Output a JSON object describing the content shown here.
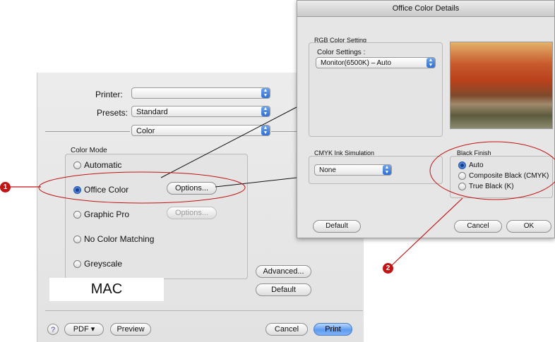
{
  "print_dialog": {
    "printer_label": "Printer:",
    "printer_value": "",
    "presets_label": "Presets:",
    "presets_value": "Standard",
    "pane_value": "Color",
    "color_mode_label": "Color Mode",
    "options": [
      {
        "label": "Automatic",
        "selected": false
      },
      {
        "label": "Office Color",
        "selected": true
      },
      {
        "label": "Graphic Pro",
        "selected": false
      },
      {
        "label": "No Color Matching",
        "selected": false
      },
      {
        "label": "Greyscale",
        "selected": false
      }
    ],
    "options_button": "Options...",
    "options_button_disabled": "Options...",
    "advanced_button": "Advanced...",
    "default_button": "Default",
    "help_button": "?",
    "pdf_button": "PDF ▾",
    "preview_button": "Preview",
    "cancel_button": "Cancel",
    "print_button": "Print"
  },
  "mac_label": "MAC",
  "details_dialog": {
    "title": "Office Color Details",
    "rgb_group_label": "RGB Color Setting",
    "color_settings_label": "Color Settings :",
    "color_settings_value": "Monitor(6500K) – Auto",
    "cmyk_group_label": "CMYK Ink Simulation",
    "cmyk_value": "None",
    "black_finish_label": "Black Finish",
    "black_finish_options": [
      {
        "label": "Auto",
        "selected": true
      },
      {
        "label": "Composite Black (CMYK)",
        "selected": false
      },
      {
        "label": "True Black (K)",
        "selected": false
      }
    ],
    "default_button": "Default",
    "cancel_button": "Cancel",
    "ok_button": "OK"
  },
  "callouts": [
    "1",
    "2"
  ],
  "colors": {
    "callout": "#c11414",
    "accent": "#3a6cc8"
  }
}
